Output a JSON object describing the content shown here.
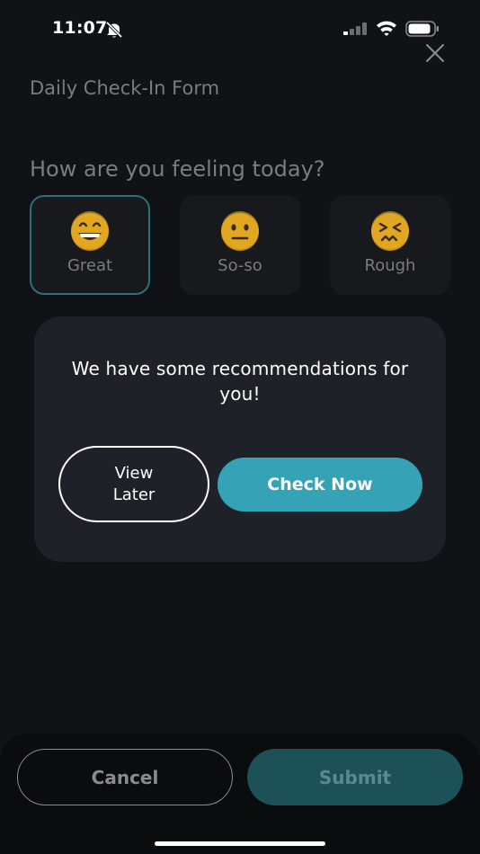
{
  "status_bar": {
    "time": "11:07",
    "icons": [
      "bell-slash-icon",
      "signal-icon",
      "wifi-icon",
      "battery-icon"
    ]
  },
  "header": {
    "title": "Daily Check-In Form",
    "close_icon": "close-icon"
  },
  "question": "How are you feeling today?",
  "moods": [
    {
      "label": "Great",
      "icon": "grinning-face-icon",
      "selected": true
    },
    {
      "label": "So-so",
      "icon": "neutral-face-icon",
      "selected": false
    },
    {
      "label": "Rough",
      "icon": "confounded-face-icon",
      "selected": false
    }
  ],
  "modal": {
    "message": "We have some recommendations for you!",
    "view_later_label": "View Later",
    "check_now_label": "Check Now"
  },
  "footer": {
    "cancel_label": "Cancel",
    "submit_label": "Submit"
  },
  "colors": {
    "background": "#111215",
    "accent": "#35a3b5",
    "modal_bg": "#1f2128",
    "muted_text": "#7a7c82"
  }
}
